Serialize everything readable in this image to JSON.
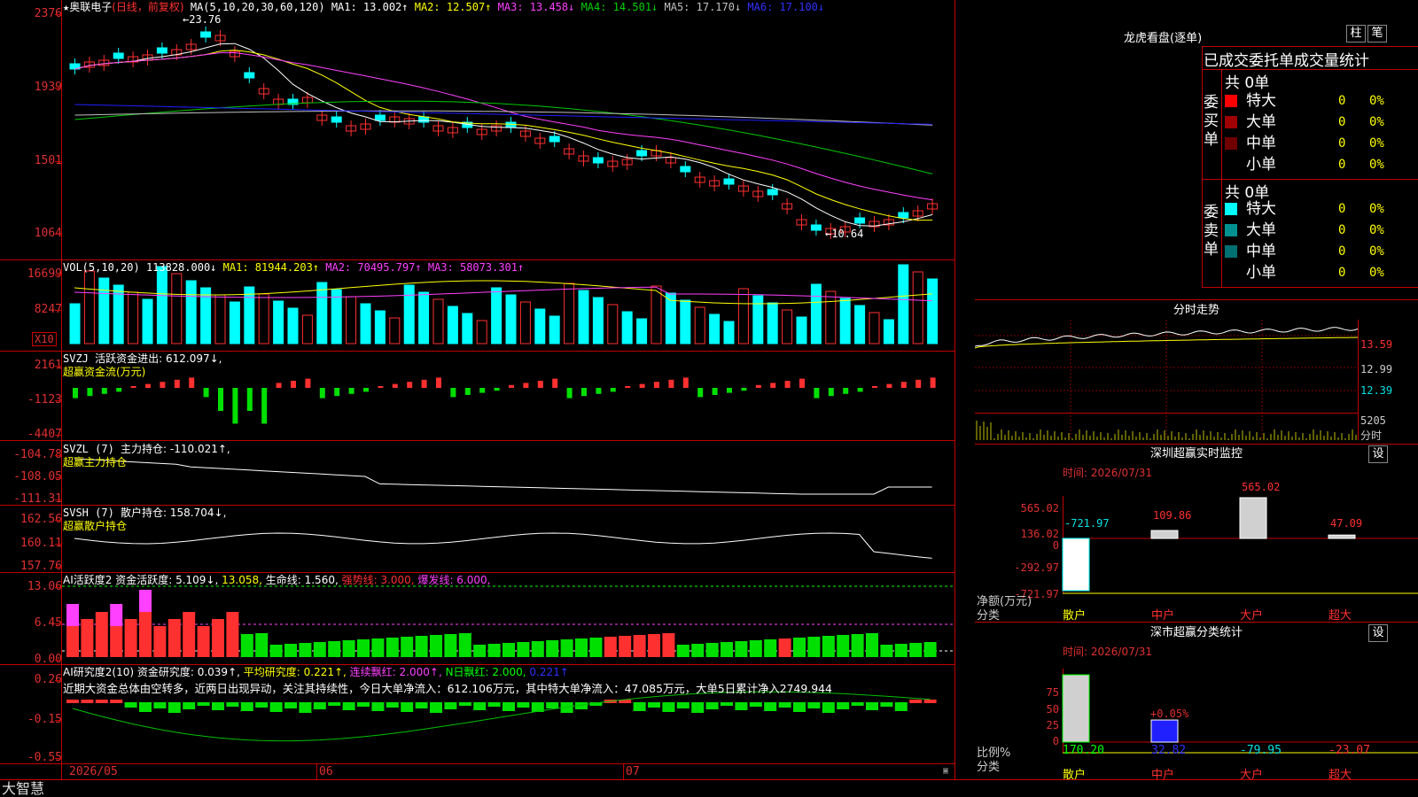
{
  "stock": {
    "name": "奥联电子",
    "mode": "(日线，前复权)",
    "star": "★"
  },
  "colors": {
    "up": "#ff3030",
    "down": "#00ffff",
    "ma1": "#ffffff",
    "ma2": "#ffff00",
    "ma3": "#ff40ff",
    "ma4": "#00c800",
    "ma5": "#c0c0c0",
    "ma6": "#2020ff",
    "axis": "#e03030"
  },
  "price_panel": {
    "indicator": "MA(5,10,20,30,60,120)",
    "ma_items": [
      {
        "label": "MA1: 13.002↑",
        "color": "#ffffff"
      },
      {
        "label": "MA2: 12.507↑",
        "color": "#ffff00"
      },
      {
        "label": "MA3: 13.458↓",
        "color": "#ff40ff"
      },
      {
        "label": "MA4: 14.501↓",
        "color": "#00d000"
      },
      {
        "label": "MA5: 17.170↓",
        "color": "#c0c0c0"
      },
      {
        "label": "MA6: 17.100↓",
        "color": "#3030ff"
      }
    ],
    "axis": [
      "2376",
      "1939",
      "1501",
      "1064"
    ],
    "high_label": "←23.76",
    "low_label": "←10.64"
  },
  "volume_panel": {
    "title": "VOL(5,10,20)",
    "value": "113828.000↓",
    "ma_items": [
      {
        "label": "MA1: 81944.203↑",
        "color": "#ffff00"
      },
      {
        "label": "MA2: 70495.797↑",
        "color": "#ff40ff"
      },
      {
        "label": "MA3: 58073.301↑",
        "color": "#ff40ff"
      }
    ],
    "axis": [
      "16699",
      "8247"
    ],
    "unit": "X10"
  },
  "svzj_panel": {
    "title": "SVZJ",
    "value_label": "活跃资金进出: 612.097↓,",
    "sub": "超赢资金流(万元)",
    "axis": [
      "2161",
      "-1123",
      "-4407"
    ]
  },
  "svzl_panel": {
    "title": "SVZL (7)",
    "value_label": "主力持仓: -110.021↑,",
    "sub": "超赢主力持仓",
    "axis": [
      "-104.78",
      "-108.05",
      "-111.31"
    ]
  },
  "svsh_panel": {
    "title": "SVSH (7)",
    "value_label": "散户持仓: 158.704↓,",
    "sub": "超赢散户持仓",
    "axis": [
      "162.56",
      "160.11",
      "157.76"
    ]
  },
  "ai_active_panel": {
    "title": "AI活跃度2",
    "items": [
      {
        "label": "资金活跃度: 5.109↓,",
        "color": "#ffffff"
      },
      {
        "label": "13.058,",
        "color": "#ffff00"
      },
      {
        "label": "生命线: 1.560,",
        "color": "#ffffff"
      },
      {
        "label": "强势线: 3.000,",
        "color": "#ff3030"
      },
      {
        "label": "爆发线: 6.000,",
        "color": "#ff40ff"
      }
    ],
    "axis": [
      "13.06",
      "6.45",
      "0.00"
    ]
  },
  "ai_research_panel": {
    "title": "AI研究度2(10)",
    "items": [
      {
        "label": "资金研究度: 0.039↑,",
        "color": "#ffffff"
      },
      {
        "label": "平均研究度: 0.221↑,",
        "color": "#ffff00"
      },
      {
        "label": "连续飘红: 2.000↑,",
        "color": "#ff40ff"
      },
      {
        "label": "N日飘红: 2.000,",
        "color": "#00ff00"
      },
      {
        "label": "0.221↑",
        "color": "#3030ff"
      }
    ],
    "commentary": "近期大资金总体由空转多，近两日出现异动，关注其持续性，今日大单净流入：612.106万元，其中特大单净流入：47.085万元，大单5日累计净入2749.944",
    "axis": [
      "0.26",
      "-0.15",
      "-0.55"
    ]
  },
  "dates": [
    "2026/05",
    "06",
    "07"
  ],
  "statusbar": {
    "brand": "大智慧"
  },
  "dragon_tiger": {
    "title": "龙虎看盘(逐单)",
    "btn_bar": "柱",
    "btn_pen": "笔",
    "header": "已成交委托单成交量统计",
    "buy_label": "委买单",
    "sell_label": "委卖单",
    "buy_total": "共 0单",
    "sell_total": "共 0单",
    "buy_rows": [
      {
        "label": "特大",
        "color": "#ff0000",
        "count": "0",
        "pct": "0%"
      },
      {
        "label": "大单",
        "color": "#a00000",
        "count": "0",
        "pct": "0%"
      },
      {
        "label": "中单",
        "color": "#700000",
        "count": "0",
        "pct": "0%"
      },
      {
        "label": "小单",
        "color": "",
        "count": "0",
        "pct": "0%"
      }
    ],
    "sell_rows": [
      {
        "label": "特大",
        "color": "#00ffff",
        "count": "0",
        "pct": "0%"
      },
      {
        "label": "大单",
        "color": "#009090",
        "count": "0",
        "pct": "0%"
      },
      {
        "label": "中单",
        "color": "#007070",
        "count": "0",
        "pct": "0%"
      },
      {
        "label": "小单",
        "color": "",
        "count": "0",
        "pct": "0%"
      }
    ]
  },
  "intraday": {
    "title": "分时走势",
    "axis": [
      "13.59",
      "12.99",
      "12.39"
    ],
    "vol_label": "5205",
    "footer": "分时"
  },
  "monitor": {
    "title": "深圳超赢实时监控",
    "gear": "设",
    "time": "时间: 2026/07/31",
    "axis": [
      "565.02",
      "136.02",
      "0",
      "-292.97",
      "-721.97"
    ],
    "net_label": "净额(万元)",
    "cat_label": "分类",
    "categories": [
      "散户",
      "中户",
      "大户",
      "超大"
    ],
    "values": [
      -721.97,
      109.86,
      565.02,
      47.09
    ],
    "value_labels": [
      "-721.97",
      "109.86",
      "565.02",
      "47.09"
    ]
  },
  "classify": {
    "title": "深市超赢分类统计",
    "gear": "设",
    "time": "时间: 2026/07/31",
    "axis": [
      "75",
      "50",
      "25",
      "0"
    ],
    "ratio_label": "比例%",
    "cat_label": "分类",
    "categories": [
      "散户",
      "中户",
      "大户",
      "超大"
    ],
    "values": [
      170.2,
      32.82,
      -79.95,
      -23.07
    ],
    "value_labels": [
      "170.20",
      "32.82",
      "-79.95",
      "-23.07"
    ],
    "mid_label": "+0.05%"
  }
}
